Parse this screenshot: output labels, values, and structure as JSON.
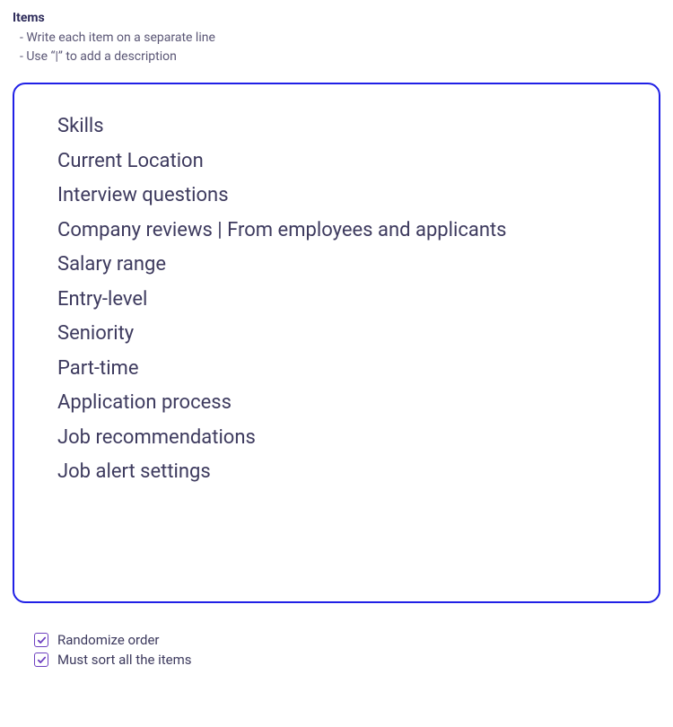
{
  "section": {
    "title": "Items",
    "hints": [
      "Write each item on a separate line",
      "Use “|” to add a description"
    ]
  },
  "items_text": "Skills\nCurrent Location\nInterview questions\nCompany reviews | From employees and applicants\nSalary range\nEntry-level\nSeniority\nPart-time\nApplication process\nJob recommendations\nJob alert settings",
  "options": {
    "randomize": {
      "label": "Randomize order",
      "checked": true
    },
    "must_sort": {
      "label": "Must sort all the items",
      "checked": true
    }
  }
}
